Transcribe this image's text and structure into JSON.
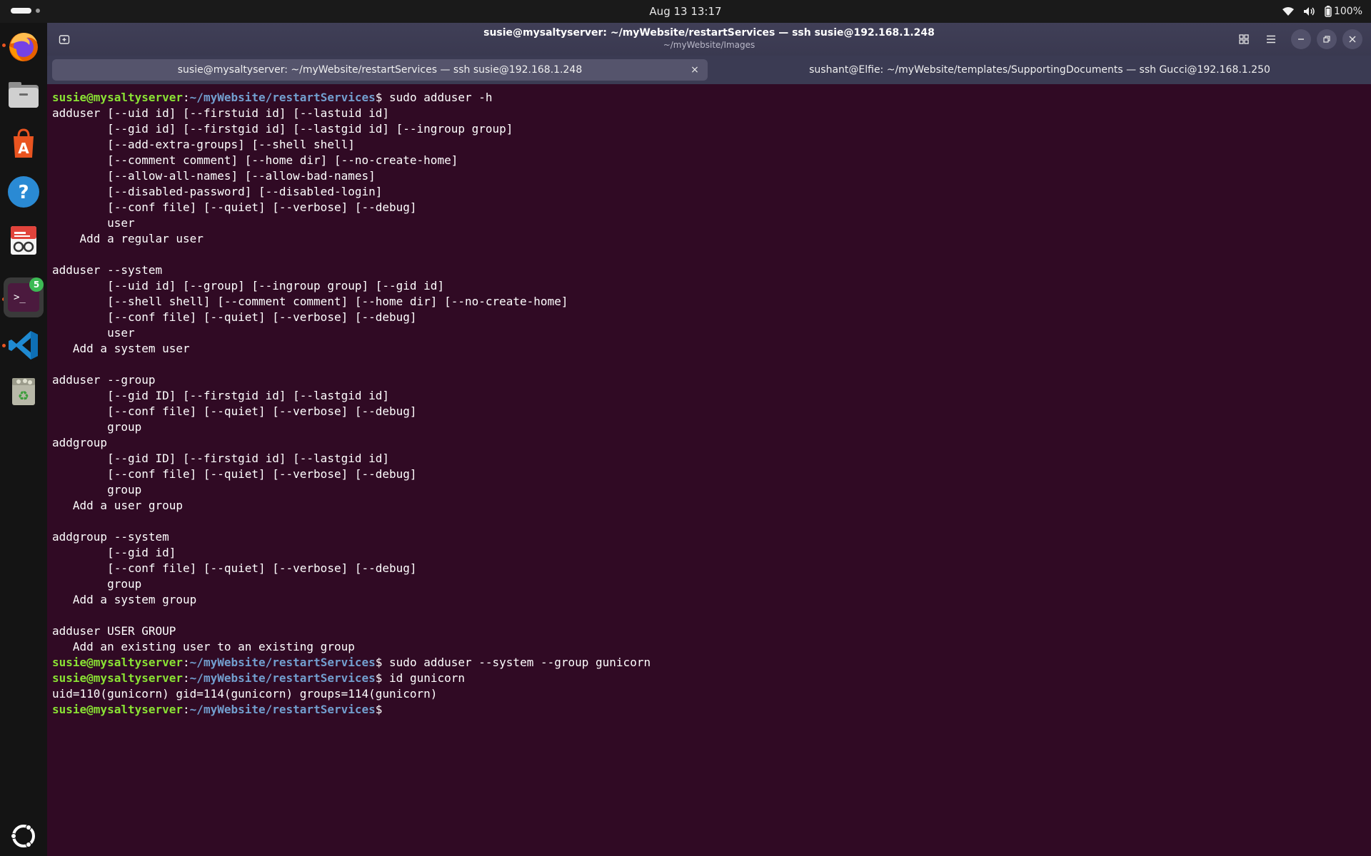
{
  "topbar": {
    "clock": "Aug 13  13:17",
    "battery": "100%",
    "icons": [
      "wifi-icon",
      "volume-icon",
      "battery-icon"
    ]
  },
  "dock": {
    "items": [
      "firefox",
      "files",
      "app-center",
      "help",
      "text-editor",
      "terminal",
      "vscode",
      "trash",
      "show-apps"
    ],
    "terminal_badge": "5"
  },
  "window": {
    "title": "susie@mysaltyserver: ~/myWebsite/restartServices — ssh susie@192.168.1.248",
    "subtitle": "~/myWebsite/Images",
    "tabs": [
      {
        "label": "susie@mysaltyserver: ~/myWebsite/restartServices — ssh susie@192.168.1.248",
        "active": true
      },
      {
        "label": "sushant@Elfie: ~/myWebsite/templates/SupportingDocuments — ssh Gucci@192.168.1.250",
        "active": false
      }
    ],
    "close_glyph": "×"
  },
  "terminal": {
    "prompt_user": "susie@mysaltyserver",
    "prompt_sep": ":",
    "prompt_path": "~/myWebsite/restartServices",
    "prompt_end": "$",
    "cmd1": " sudo adduser -h",
    "output1": [
      "adduser [--uid id] [--firstuid id] [--lastuid id]",
      "        [--gid id] [--firstgid id] [--lastgid id] [--ingroup group]",
      "        [--add-extra-groups] [--shell shell]",
      "        [--comment comment] [--home dir] [--no-create-home]",
      "        [--allow-all-names] [--allow-bad-names]",
      "        [--disabled-password] [--disabled-login]",
      "        [--conf file] [--quiet] [--verbose] [--debug]",
      "        user",
      "    Add a regular user",
      "",
      "adduser --system",
      "        [--uid id] [--group] [--ingroup group] [--gid id]",
      "        [--shell shell] [--comment comment] [--home dir] [--no-create-home]",
      "        [--conf file] [--quiet] [--verbose] [--debug]",
      "        user",
      "   Add a system user",
      "",
      "adduser --group",
      "        [--gid ID] [--firstgid id] [--lastgid id]",
      "        [--conf file] [--quiet] [--verbose] [--debug]",
      "        group",
      "addgroup",
      "        [--gid ID] [--firstgid id] [--lastgid id]",
      "        [--conf file] [--quiet] [--verbose] [--debug]",
      "        group",
      "   Add a user group",
      "",
      "addgroup --system",
      "        [--gid id]",
      "        [--conf file] [--quiet] [--verbose] [--debug]",
      "        group",
      "   Add a system group",
      "",
      "adduser USER GROUP",
      "   Add an existing user to an existing group"
    ],
    "cmd2": " sudo adduser --system --group gunicorn",
    "cmd3": " id gunicorn",
    "output3": "uid=110(gunicorn) gid=114(gunicorn) groups=114(gunicorn)"
  }
}
